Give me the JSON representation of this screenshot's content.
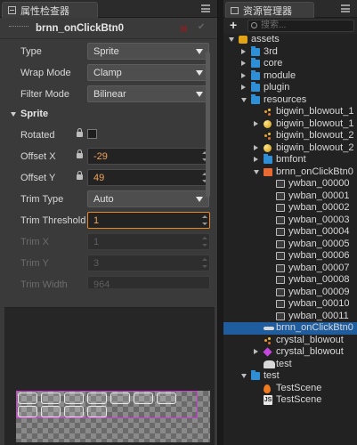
{
  "inspector": {
    "tab_title": "属性检查器",
    "node_name": "brnn_onClickBtn0",
    "rows": {
      "type": {
        "label": "Type",
        "value": "Sprite"
      },
      "wrap_mode": {
        "label": "Wrap Mode",
        "value": "Clamp"
      },
      "filter_mode": {
        "label": "Filter Mode",
        "value": "Bilinear"
      },
      "sprite_section": "Sprite",
      "rotated": {
        "label": "Rotated"
      },
      "offset_x": {
        "label": "Offset X",
        "value": "-29"
      },
      "offset_y": {
        "label": "Offset Y",
        "value": "49"
      },
      "trim_type": {
        "label": "Trim Type",
        "value": "Auto"
      },
      "trim_threshold": {
        "label": "Trim Threshold",
        "value": "1"
      },
      "trim_x": {
        "label": "Trim X",
        "value": "1"
      },
      "trim_y": {
        "label": "Trim Y",
        "value": "3"
      },
      "trim_width": {
        "label": "Trim Width",
        "value": "964"
      }
    }
  },
  "assets": {
    "tab_title": "资源管理器",
    "search_placeholder": "搜索...",
    "tree": [
      {
        "name": "assets",
        "level": 0,
        "icon": "db-icon",
        "arrow": "open"
      },
      {
        "name": "3rd",
        "level": 1,
        "icon": "folder-icon",
        "arrow": "closed"
      },
      {
        "name": "core",
        "level": 1,
        "icon": "folder-icon",
        "arrow": "closed"
      },
      {
        "name": "module",
        "level": 1,
        "icon": "folder-icon",
        "arrow": "closed"
      },
      {
        "name": "plugin",
        "level": 1,
        "icon": "folder-icon",
        "arrow": "closed"
      },
      {
        "name": "resources",
        "level": 1,
        "icon": "folder-icon",
        "arrow": "open"
      },
      {
        "name": "bigwin_blowout_1",
        "level": 2,
        "icon": "particle-icon",
        "arrow": "none"
      },
      {
        "name": "bigwin_blowout_1",
        "level": 2,
        "icon": "anim-icon",
        "arrow": "closed"
      },
      {
        "name": "bigwin_blowout_2",
        "level": 2,
        "icon": "particle-icon",
        "arrow": "none"
      },
      {
        "name": "bigwin_blowout_2",
        "level": 2,
        "icon": "anim-icon",
        "arrow": "closed"
      },
      {
        "name": "bmfont",
        "level": 2,
        "icon": "folder-icon",
        "arrow": "closed"
      },
      {
        "name": "brnn_onClickBtn0",
        "level": 2,
        "icon": "atlas-icon",
        "arrow": "open"
      },
      {
        "name": "ywban_00000",
        "level": 3,
        "icon": "sprite-frame-icon",
        "arrow": "none"
      },
      {
        "name": "ywban_00001",
        "level": 3,
        "icon": "sprite-frame-icon",
        "arrow": "none"
      },
      {
        "name": "ywban_00002",
        "level": 3,
        "icon": "sprite-frame-icon",
        "arrow": "none"
      },
      {
        "name": "ywban_00003",
        "level": 3,
        "icon": "sprite-frame-icon",
        "arrow": "none"
      },
      {
        "name": "ywban_00004",
        "level": 3,
        "icon": "sprite-frame-icon",
        "arrow": "none"
      },
      {
        "name": "ywban_00005",
        "level": 3,
        "icon": "sprite-frame-icon",
        "arrow": "none"
      },
      {
        "name": "ywban_00006",
        "level": 3,
        "icon": "sprite-frame-icon",
        "arrow": "none"
      },
      {
        "name": "ywban_00007",
        "level": 3,
        "icon": "sprite-frame-icon",
        "arrow": "none"
      },
      {
        "name": "ywban_00008",
        "level": 3,
        "icon": "sprite-frame-icon",
        "arrow": "none"
      },
      {
        "name": "ywban_00009",
        "level": 3,
        "icon": "sprite-frame-icon",
        "arrow": "none"
      },
      {
        "name": "ywban_00010",
        "level": 3,
        "icon": "sprite-frame-icon",
        "arrow": "none"
      },
      {
        "name": "ywban_00011",
        "level": 3,
        "icon": "sprite-frame-icon",
        "arrow": "none"
      },
      {
        "name": "brnn_onClickBtn0",
        "level": 2,
        "icon": "anim-clip-icon",
        "arrow": "none",
        "selected": true
      },
      {
        "name": "crystal_blowout",
        "level": 2,
        "icon": "particle-icon",
        "arrow": "none"
      },
      {
        "name": "crystal_blowout",
        "level": 2,
        "icon": "gem-icon",
        "arrow": "closed"
      },
      {
        "name": "test",
        "level": 2,
        "icon": "skeleton-icon",
        "arrow": "none"
      },
      {
        "name": "test",
        "level": 1,
        "icon": "folder-icon",
        "arrow": "open"
      },
      {
        "name": "TestScene",
        "level": 2,
        "icon": "scene-icon",
        "arrow": "none"
      },
      {
        "name": "TestScene",
        "level": 2,
        "icon": "js-icon",
        "arrow": "none"
      }
    ]
  },
  "colors": {
    "accent_selected": "#1f5d9e",
    "value_orange": "#f0a25a",
    "sprite_outline": "#d23bd6"
  }
}
